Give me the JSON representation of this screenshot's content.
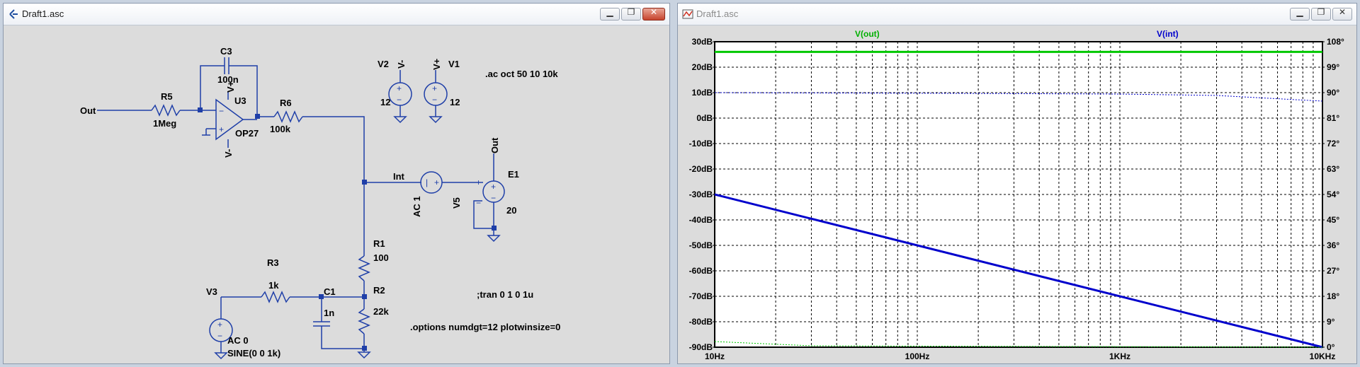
{
  "schematic": {
    "title": "Draft1.asc",
    "labels": {
      "c3": "C3",
      "c3_val": "100n",
      "u3": "U3",
      "u3_model": "OP27",
      "vplus": "V+",
      "vminus": "V-",
      "r5": "R5",
      "r5_val": "1Meg",
      "r6": "R6",
      "r6_val": "100k",
      "out_left": "Out",
      "out_top": "Out",
      "int": "Int",
      "v5": "V5",
      "v5_ac": "AC 1",
      "e1": "E1",
      "e1_val": "20",
      "v2": "V2",
      "v2_node": "V-",
      "v2_val": "12",
      "v1": "V1",
      "v1_node": "V+",
      "v1_val": "12",
      "r1": "R1",
      "r1_val": "100",
      "r2": "R2",
      "r2_val": "22k",
      "r3": "R3",
      "r3_val": "1k",
      "c1": "C1",
      "c1_val": "1n",
      "v3": "V3",
      "v3_ac": "AC 0",
      "v3_sine": "SINE(0 0 1k)"
    },
    "directives": {
      "ac": ".ac oct 50 10 10k",
      "tran": ";tran 0 1 0 1u",
      "options": ".options numdgt=12 plotwinsize=0"
    }
  },
  "plot": {
    "title": "Draft1.asc",
    "trace_labels": {
      "vout": "V(out)",
      "vint": "V(int)"
    },
    "colors": {
      "vout": "#00c800",
      "vint": "#0000cc"
    },
    "y_left_ticks": [
      "30dB",
      "20dB",
      "10dB",
      "0dB",
      "-10dB",
      "-20dB",
      "-30dB",
      "-40dB",
      "-50dB",
      "-60dB",
      "-70dB",
      "-80dB",
      "-90dB"
    ],
    "y_right_ticks": [
      "108°",
      "99°",
      "90°",
      "81°",
      "72°",
      "63°",
      "54°",
      "45°",
      "36°",
      "27°",
      "18°",
      "9°",
      "0°"
    ],
    "x_ticks": [
      "10Hz",
      "100Hz",
      "1KHz",
      "10KHz"
    ]
  },
  "chart_data": {
    "type": "line",
    "x_scale": "log",
    "x": [
      10,
      10000
    ],
    "xlim": [
      10,
      10000
    ],
    "ylim": [
      -90,
      30
    ],
    "y2lim": [
      0,
      108
    ],
    "grid": true,
    "series": [
      {
        "name": "V(out)",
        "kind": "magnitude_dB",
        "x": [
          10,
          10000
        ],
        "values": [
          26,
          26
        ]
      },
      {
        "name": "V(int)",
        "kind": "magnitude_dB",
        "x": [
          10,
          10000
        ],
        "values": [
          -30,
          -90
        ]
      },
      {
        "name": "V(int)",
        "kind": "phase_deg",
        "x": [
          10,
          100,
          1000,
          3000,
          10000
        ],
        "values": [
          90,
          89.8,
          89.5,
          89,
          87
        ]
      },
      {
        "name": "V(out)",
        "kind": "phase_deg",
        "x": [
          10,
          30,
          10000
        ],
        "values": [
          2,
          0.5,
          0
        ]
      }
    ]
  }
}
